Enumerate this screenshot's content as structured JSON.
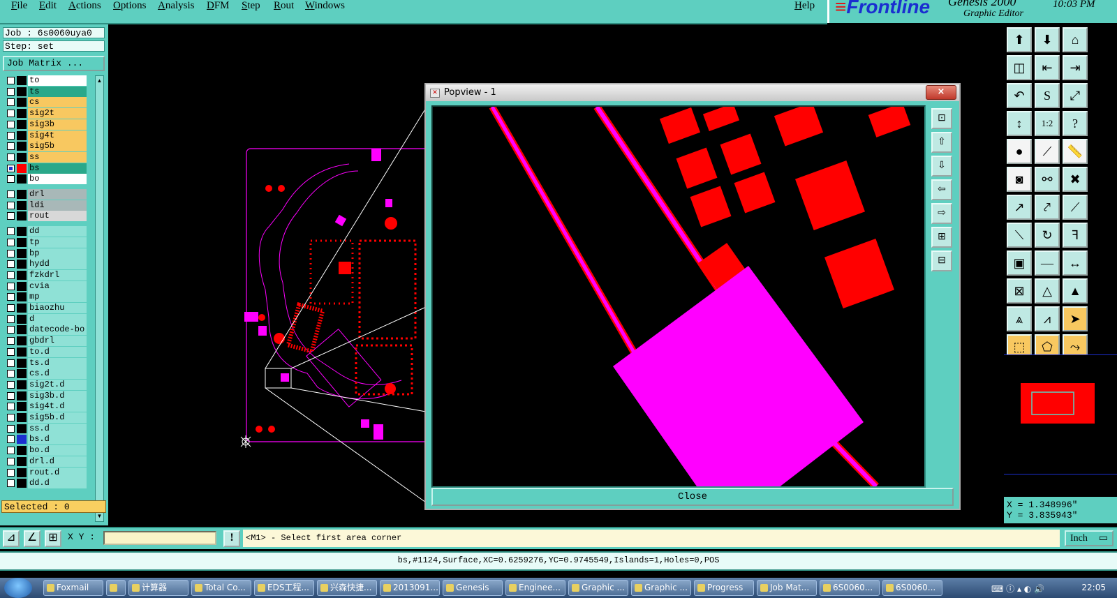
{
  "menu": {
    "items": [
      "File",
      "Edit",
      "Actions",
      "Options",
      "Analysis",
      "DFM",
      "Step",
      "Rout",
      "Windows"
    ],
    "help": "Help"
  },
  "brand": {
    "logo": "Frontline",
    "product": "Genesis 2000",
    "subtitle": "Graphic Editor",
    "time": "10:03 PM"
  },
  "left": {
    "job": "Job : 6s0060uya0",
    "step": "Step: set",
    "job_matrix": "Job Matrix ...",
    "selected": "Selected : 0"
  },
  "layers": [
    {
      "name": "to",
      "color": "#ffffff",
      "swatch": "#000000",
      "checked": false
    },
    {
      "name": "ts",
      "color": "#2aa88a",
      "swatch": "#000000",
      "checked": false
    },
    {
      "name": "cs",
      "color": "#f8c860",
      "swatch": "#000000",
      "checked": false
    },
    {
      "name": "sig2t",
      "color": "#f8c860",
      "swatch": "#000000",
      "checked": false
    },
    {
      "name": "sig3b",
      "color": "#f8c860",
      "swatch": "#000000",
      "checked": false
    },
    {
      "name": "sig4t",
      "color": "#f8c860",
      "swatch": "#000000",
      "checked": false
    },
    {
      "name": "sig5b",
      "color": "#f8c860",
      "swatch": "#000000",
      "checked": false
    },
    {
      "name": "ss",
      "color": "#f8c860",
      "swatch": "#000000",
      "checked": false
    },
    {
      "name": "bs",
      "color": "#2aa88a",
      "swatch": "#ff0000",
      "checked": true
    },
    {
      "name": "bo",
      "color": "#ffffff",
      "swatch": "#000000",
      "checked": false
    },
    {
      "name": "drl",
      "color": "#a8b8b8",
      "swatch": "#000000",
      "checked": false
    },
    {
      "name": "ldi",
      "color": "#a8b8b8",
      "swatch": "#000000",
      "checked": false
    },
    {
      "name": "rout",
      "color": "#d8d8d8",
      "swatch": "#000000",
      "checked": false
    },
    {
      "name": "dd",
      "color": "#8fe1d6",
      "swatch": "#000000",
      "checked": false
    },
    {
      "name": "tp",
      "color": "#8fe1d6",
      "swatch": "#000000",
      "checked": false
    },
    {
      "name": "bp",
      "color": "#8fe1d6",
      "swatch": "#000000",
      "checked": false
    },
    {
      "name": "hydd",
      "color": "#8fe1d6",
      "swatch": "#000000",
      "checked": false
    },
    {
      "name": "fzkdrl",
      "color": "#8fe1d6",
      "swatch": "#000000",
      "checked": false
    },
    {
      "name": "cvia",
      "color": "#8fe1d6",
      "swatch": "#000000",
      "checked": false
    },
    {
      "name": "mp",
      "color": "#8fe1d6",
      "swatch": "#000000",
      "checked": false
    },
    {
      "name": "biaozhu",
      "color": "#8fe1d6",
      "swatch": "#000000",
      "checked": false
    },
    {
      "name": "d",
      "color": "#8fe1d6",
      "swatch": "#000000",
      "checked": false
    },
    {
      "name": "datecode-bo",
      "color": "#8fe1d6",
      "swatch": "#000000",
      "checked": false
    },
    {
      "name": "gbdrl",
      "color": "#8fe1d6",
      "swatch": "#000000",
      "checked": false
    },
    {
      "name": "to.d",
      "color": "#8fe1d6",
      "swatch": "#000000",
      "checked": false
    },
    {
      "name": "ts.d",
      "color": "#8fe1d6",
      "swatch": "#000000",
      "checked": false
    },
    {
      "name": "cs.d",
      "color": "#8fe1d6",
      "swatch": "#000000",
      "checked": false
    },
    {
      "name": "sig2t.d",
      "color": "#8fe1d6",
      "swatch": "#000000",
      "checked": false
    },
    {
      "name": "sig3b.d",
      "color": "#8fe1d6",
      "swatch": "#000000",
      "checked": false
    },
    {
      "name": "sig4t.d",
      "color": "#8fe1d6",
      "swatch": "#000000",
      "checked": false
    },
    {
      "name": "sig5b.d",
      "color": "#8fe1d6",
      "swatch": "#000000",
      "checked": false
    },
    {
      "name": "ss.d",
      "color": "#8fe1d6",
      "swatch": "#000000",
      "checked": false
    },
    {
      "name": "bs.d",
      "color": "#8fe1d6",
      "swatch": "#1b2fd0",
      "checked": false
    },
    {
      "name": "bo.d",
      "color": "#8fe1d6",
      "swatch": "#000000",
      "checked": false
    },
    {
      "name": "drl.d",
      "color": "#8fe1d6",
      "swatch": "#000000",
      "checked": false
    },
    {
      "name": "rout.d",
      "color": "#8fe1d6",
      "swatch": "#000000",
      "checked": false
    },
    {
      "name": "dd.d",
      "color": "#8fe1d6",
      "swatch": "#000000",
      "checked": false
    }
  ],
  "popview": {
    "title": "Popview - 1",
    "close_label": "Close",
    "close_x": "×"
  },
  "right": {
    "x": "X = 1.348996\"",
    "y": "Y = 3.835943\""
  },
  "command": {
    "xy_label": "X Y :",
    "xy_value": "",
    "prompt": "<M1> - Select first area corner",
    "units": "Inch"
  },
  "status": "bs,#1124,Surface,XC=0.6259276,YC=0.9745549,Islands=1,Holes=0,POS",
  "taskbar": {
    "items": [
      "Foxmail",
      "",
      "计算器",
      "Total Co...",
      "EDS工程...",
      "兴森快捷...",
      "2013091...",
      "Genesis",
      "Enginee...",
      "Graphic ...",
      "Graphic ...",
      "Progress",
      "Job Mat...",
      "6S0060...",
      "6S0060..."
    ],
    "clock": "22:05"
  },
  "colors": {
    "panel": "#5ecfc0",
    "pad": "#ff0000",
    "surface": "#ff00ff",
    "highlight": "#f8c860"
  }
}
